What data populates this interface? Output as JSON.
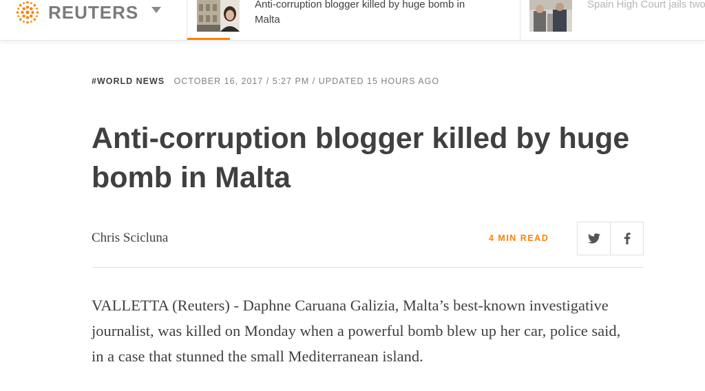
{
  "header": {
    "logo_text": "REUTERS",
    "logo_icon": "reuters-dot-circle-logo",
    "menu_icon": "caret-down",
    "accent_color": "#ff8000",
    "stories": [
      {
        "headline": "Anti-corruption blogger killed by huge bomb in Malta",
        "active": true
      },
      {
        "headline": "Spain High Court jails two separatist leaders pending",
        "active": false
      }
    ]
  },
  "article": {
    "section": "#WORLD NEWS",
    "dateline": "OCTOBER 16, 2017 / 5:27 PM / UPDATED 15 HOURS AGO",
    "title": "Anti-corruption blogger killed by huge bomb in Malta",
    "author": "Chris Scicluna",
    "read_time": "4 MIN READ",
    "share_icons": [
      "twitter",
      "facebook"
    ],
    "lede": "VALLETTA (Reuters) - Daphne Caruana Galizia, Malta’s best-known investigative journalist, was killed on Monday when a powerful bomb blew up her car, police said, in a case that stunned the small Mediterranean island."
  }
}
